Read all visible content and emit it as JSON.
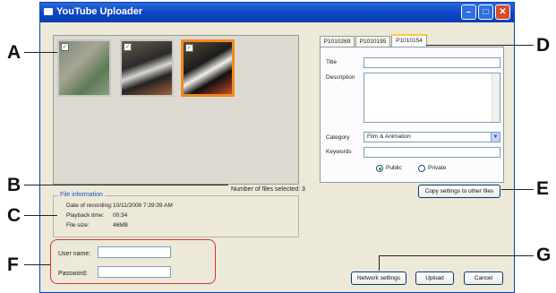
{
  "window": {
    "title": "YouTube Uploader"
  },
  "callouts": {
    "a": "A",
    "b": "B",
    "c": "C",
    "d": "D",
    "e": "E",
    "f": "F",
    "g": "G"
  },
  "gallery": {
    "thumbnails": [
      {
        "selected": false,
        "checked": true
      },
      {
        "selected": false,
        "checked": true
      },
      {
        "selected": true,
        "checked": true
      }
    ],
    "selected_count_label": "Number of files selected:",
    "selected_count": "3"
  },
  "file_info": {
    "legend": "File information",
    "rows": [
      {
        "key": "Date of recording:",
        "value": "10/11/2008 7:39:39 AM"
      },
      {
        "key": "Playback time:",
        "value": "00:34"
      },
      {
        "key": "File size:",
        "value": "46MB"
      }
    ]
  },
  "login": {
    "username_label": "User name:",
    "password_label": "Password:",
    "username_value": "",
    "password_value": ""
  },
  "tabs": [
    "P1010269",
    "P1010195",
    "P1010154"
  ],
  "active_tab": 2,
  "form": {
    "title_label": "Title",
    "description_label": "Description",
    "category_label": "Category",
    "category_value": "Film & Animation",
    "keywords_label": "Keywords",
    "privacy_public": "Public",
    "privacy_private": "Private",
    "privacy_selected": "Public"
  },
  "buttons": {
    "copy_settings": "Copy settings to other files",
    "network_settings": "Network settings",
    "upload": "Upload",
    "cancel": "Cancel"
  },
  "colors": {
    "highlight": "#d9322a",
    "titlebar": "#0b47c6",
    "selected_thumb": "#f08a1c"
  }
}
